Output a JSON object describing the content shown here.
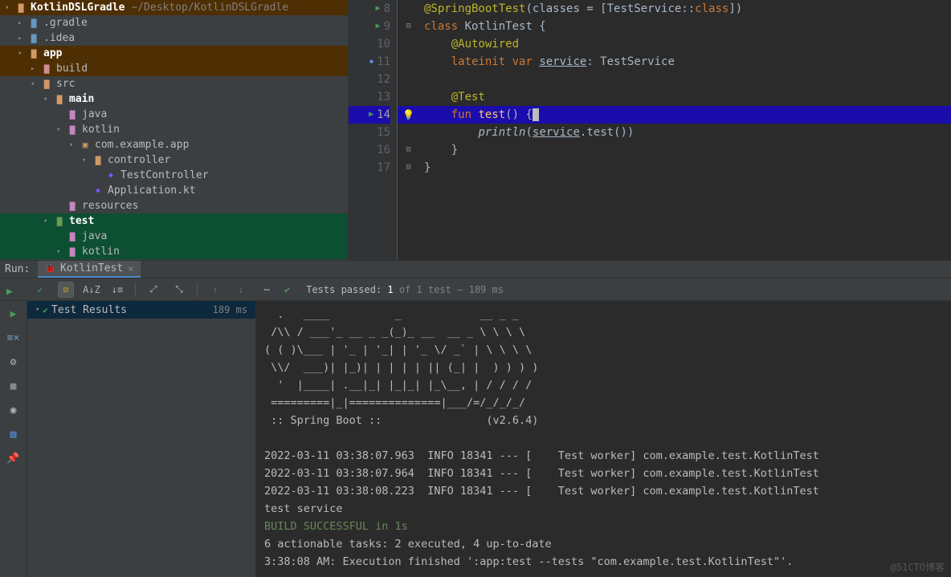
{
  "project": {
    "root_name": "KotlinDSLGradle",
    "root_path": "~/Desktop/KotlinDSLGradle",
    "nodes": [
      {
        "depth": 0,
        "expanded": true,
        "bold": true,
        "cls": "root",
        "icon": "folder",
        "icolor": "folder-orange",
        "label": "KotlinDSLGradle",
        "suffix": "~/Desktop/KotlinDSLGradle"
      },
      {
        "depth": 1,
        "expanded": false,
        "icon": "folder",
        "icolor": "folder-blue",
        "label": ".gradle"
      },
      {
        "depth": 1,
        "expanded": false,
        "icon": "folder",
        "icolor": "folder-blue",
        "label": ".idea"
      },
      {
        "depth": 1,
        "expanded": true,
        "bold": true,
        "cls": "app",
        "icon": "folder",
        "icolor": "folder-orange",
        "label": "app"
      },
      {
        "depth": 2,
        "expanded": false,
        "cls": "build",
        "icon": "folder",
        "icolor": "folder-reddish",
        "label": "build"
      },
      {
        "depth": 2,
        "expanded": true,
        "icon": "folder",
        "icolor": "folder-orange",
        "label": "src"
      },
      {
        "depth": 3,
        "expanded": true,
        "bold": true,
        "icon": "folder",
        "icolor": "folder-orange",
        "label": "main"
      },
      {
        "depth": 4,
        "noarrow": true,
        "icon": "folder",
        "icolor": "folder-purple",
        "label": "java"
      },
      {
        "depth": 4,
        "expanded": true,
        "icon": "folder",
        "icolor": "folder-purple",
        "label": "kotlin"
      },
      {
        "depth": 5,
        "expanded": true,
        "icon": "pkg",
        "icolor": "folder-orange",
        "label": "com.example.app"
      },
      {
        "depth": 6,
        "expanded": true,
        "icon": "folder",
        "icolor": "folder-orange",
        "label": "controller"
      },
      {
        "depth": 7,
        "noarrow": true,
        "icon": "kt",
        "label": "TestController"
      },
      {
        "depth": 6,
        "noarrow": true,
        "icon": "kt",
        "label": "Application.kt"
      },
      {
        "depth": 4,
        "noarrow": true,
        "icon": "folder",
        "icolor": "folder-purple",
        "label": "resources"
      },
      {
        "depth": 3,
        "expanded": true,
        "bold": true,
        "cls": "test",
        "icon": "folder",
        "icolor": "folder-green",
        "label": "test"
      },
      {
        "depth": 4,
        "noarrow": true,
        "cls": "testjava",
        "icon": "folder",
        "icolor": "folder-purple",
        "label": "java"
      },
      {
        "depth": 4,
        "expanded": true,
        "cls": "testkotlin",
        "icon": "folder",
        "icolor": "folder-purple",
        "label": "kotlin"
      }
    ]
  },
  "editor": {
    "lines": [
      {
        "n": 8,
        "run": true,
        "html": "<span class='ann'>@SpringBootTest</span><span class='ident'>(classes = [TestService::</span><span class='kw'>class</span><span class='ident'>])</span>"
      },
      {
        "n": 9,
        "run": true,
        "fold": "⊟",
        "html": "<span class='kw'>class</span> <span class='ident'>KotlinTest {</span>"
      },
      {
        "n": 10,
        "html": "    <span class='ann'>@Autowired</span>"
      },
      {
        "n": 11,
        "blue": true,
        "html": "    <span class='kw'>lateinit var</span> <span class='ident underl'>service</span><span class='ident'>: TestService</span>"
      },
      {
        "n": 12,
        "html": ""
      },
      {
        "n": 13,
        "html": "    <span class='ann'>@Test</span>"
      },
      {
        "n": 14,
        "run": true,
        "hl": true,
        "bulb": true,
        "fold": "⊟",
        "html": "    <span class='kw'>fun</span> <span class='fn'>test</span><span class='ident'>() {</span><span class='cursor'></span>"
      },
      {
        "n": 15,
        "html": "        <span class='ident italic'>println</span><span class='ident'>(</span><span class='ident underl'>service</span><span class='ident'>.test())</span>"
      },
      {
        "n": 16,
        "fold": "⊟",
        "html": "    <span class='ident'>}</span>"
      },
      {
        "n": 17,
        "fold": "⊟",
        "html": "<span class='ident'>}</span>"
      }
    ]
  },
  "run": {
    "label": "Run:",
    "tab": "KotlinTest",
    "status_prefix": "Tests passed:",
    "status_passed": "1",
    "status_of": "of",
    "status_total": "1 test",
    "status_time": "189 ms",
    "tree_root": "Test Results",
    "tree_time": "189 ms",
    "console": "  .   ____          _            __ _ _\n /\\\\ / ___'_ __ _ _(_)_ __  __ _ \\ \\ \\ \\\n( ( )\\___ | '_ | '_| | '_ \\/ _` | \\ \\ \\ \\\n \\\\/  ___)| |_)| | | | | || (_| |  ) ) ) )\n  '  |____| .__|_| |_|_| |_\\__, | / / / /\n =========|_|==============|___/=/_/_/_/\n :: Spring Boot ::                (v2.6.4)\n\n2022-03-11 03:38:07.963  INFO 18341 --- [    Test worker] com.example.test.KotlinTest\n2022-03-11 03:38:07.964  INFO 18341 --- [    Test worker] com.example.test.KotlinTest\n2022-03-11 03:38:08.223  INFO 18341 --- [    Test worker] com.example.test.KotlinTest\ntest service",
    "console_tail1": "BUILD SUCCESSFUL in 1s",
    "console_tail2": "6 actionable tasks: 2 executed, 4 up-to-date",
    "console_tail3": "3:38:08 AM: Execution finished ':app:test --tests \"com.example.test.KotlinTest\"'."
  },
  "watermark": "@51CTO博客"
}
